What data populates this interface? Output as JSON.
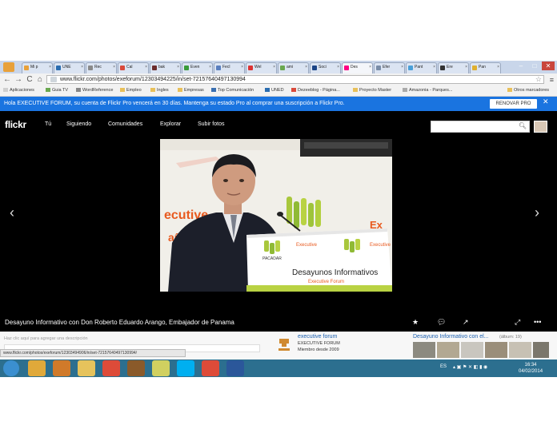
{
  "browser": {
    "tabs": [
      {
        "label": "Mi p",
        "color": "#e8a13a"
      },
      {
        "label": "UNE",
        "color": "#2b6db0"
      },
      {
        "label": "Rec",
        "color": "#8a8a8a"
      },
      {
        "label": "Cal",
        "color": "#d94a3b"
      },
      {
        "label": "bak",
        "color": "#6b2c2c"
      },
      {
        "label": "Even",
        "color": "#3a9c3a"
      },
      {
        "label": "Fecl",
        "color": "#5a7fbf"
      },
      {
        "label": "Wel",
        "color": "#d33"
      },
      {
        "label": "ami",
        "color": "#6aa84f"
      },
      {
        "label": "Soci",
        "color": "#1c4587"
      },
      {
        "label": "Des",
        "color": "#ff0084",
        "active": true
      },
      {
        "label": "Efer",
        "color": "#7a8da8"
      },
      {
        "label": "Pant",
        "color": "#4aa0d8"
      },
      {
        "label": "Ere",
        "color": "#333"
      },
      {
        "label": "Pan",
        "color": "#e0b030"
      }
    ],
    "url": "www.flickr.com/photos/exeforum/12303494225/in/set-72157640497130994",
    "bookmarks": [
      "Aplicaciones",
      "Guia TV",
      "WordReference",
      "Empleo",
      "Ingles",
      "Empresas",
      "Top Comunicación",
      "UNED",
      "Dezeeblog - Página...",
      "Proyecto Master",
      "Amazonia - Parques...",
      "Otros marcadores"
    ]
  },
  "notice": {
    "text": "Hola EXECUTIVE FORUM, su cuenta de Flickr Pro vencerá en 30 días. Mantenga su estado Pro al comprar una suscripción a Flickr Pro.",
    "button": "RENOVAR PRO",
    "close": "✕"
  },
  "flickr_nav": {
    "logo": "flickr",
    "links": [
      "Tú",
      "Siguiendo",
      "Comunidades",
      "Explorar",
      "Subir fotos"
    ]
  },
  "photo": {
    "banner_left": "ecutive",
    "banner_left2": "aña",
    "banner_right": "Ex\nFor",
    "podium_text": "Desayunos Informativos",
    "podium_sub": "Executive Forum",
    "sponsor": "PACADAR"
  },
  "caption": "Desayuno Informativo con Don Roberto Eduardo Arango, Embajador de Panama",
  "description_placeholder": "Haz clic aquí para agregar una descripción",
  "owner": {
    "name": "executive forum",
    "subtitle": "EXECUTIVE FORUM",
    "since": "Miembro desde 2009"
  },
  "album": {
    "title": "Desayuno Informativo con el...",
    "count": "(álbum: 19)"
  },
  "status_url": "www.flickr.com/photos/exeforum/12303494906/in/set-72157640497130994/",
  "taskbar": {
    "lang": "ES",
    "time": "16:34",
    "date": "04/02/2014",
    "apps": [
      {
        "name": "start",
        "color": "#3b8fd0"
      },
      {
        "name": "folder",
        "color": "#e0a93a"
      },
      {
        "name": "media",
        "color": "#d07a2a"
      },
      {
        "name": "explorer",
        "color": "#e6c35c"
      },
      {
        "name": "chrome",
        "color": "#dd4b39"
      },
      {
        "name": "app",
        "color": "#8a5a2a"
      },
      {
        "name": "photos",
        "color": "#d0d060"
      },
      {
        "name": "skype",
        "color": "#00aff0"
      },
      {
        "name": "chrome2",
        "color": "#dd4b39"
      },
      {
        "name": "word",
        "color": "#2b579a"
      }
    ]
  }
}
